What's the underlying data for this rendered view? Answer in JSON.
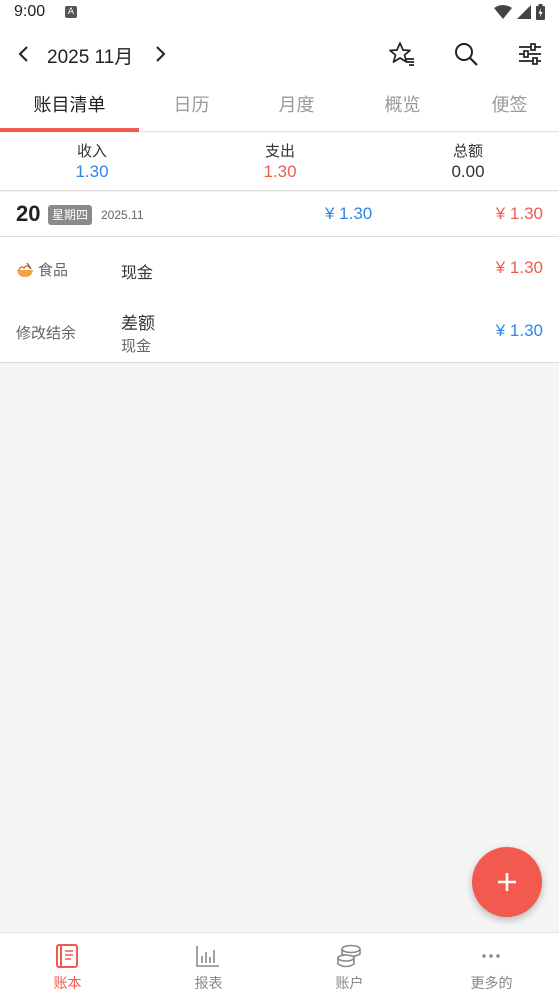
{
  "status_bar": {
    "time": "9:00",
    "notification": "A"
  },
  "header": {
    "month_title": "2025 11月"
  },
  "tabs": [
    {
      "label": "账目清单",
      "active": true
    },
    {
      "label": "日历",
      "active": false
    },
    {
      "label": "月度",
      "active": false
    },
    {
      "label": "概览",
      "active": false
    },
    {
      "label": "便签",
      "active": false
    }
  ],
  "summary": {
    "income_label": "收入",
    "income_value": "1.30",
    "expense_label": "支出",
    "expense_value": "1.30",
    "total_label": "总额",
    "total_value": "0.00"
  },
  "day_group": {
    "day": "20",
    "weekday": "星期四",
    "year_month": "2025.11",
    "income": "¥ 1.30",
    "expense": "¥ 1.30"
  },
  "entries": [
    {
      "category": "食品",
      "icon": "noodle-bowl-icon",
      "account": "现金",
      "amount": "¥ 1.30",
      "type": "expense"
    },
    {
      "category": "修改结余",
      "title": "差额",
      "account": "现金",
      "amount": "¥ 1.30",
      "type": "income"
    }
  ],
  "bottom_nav": [
    {
      "label": "账本",
      "icon": "ledger-book-icon",
      "active": true
    },
    {
      "label": "报表",
      "icon": "bar-chart-icon",
      "active": false
    },
    {
      "label": "账户",
      "icon": "coins-stack-icon",
      "active": false
    },
    {
      "label": "更多的",
      "icon": "more-dots-icon",
      "active": false
    }
  ],
  "colors": {
    "accent": "#f05a4f",
    "income": "#2f86e8",
    "expense": "#f05a4f"
  }
}
